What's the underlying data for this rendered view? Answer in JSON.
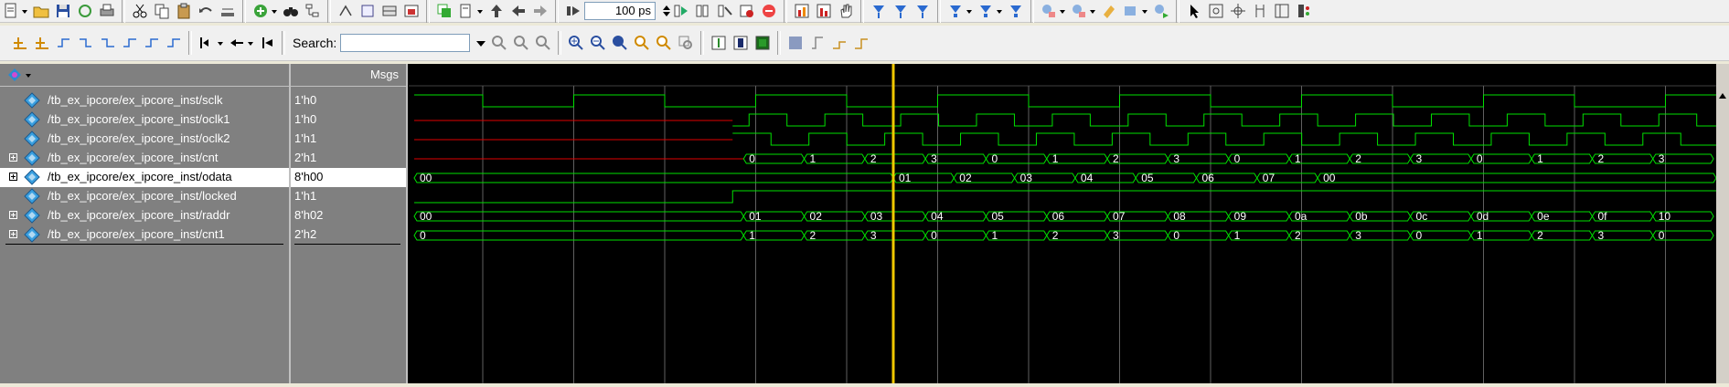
{
  "toolbar": {
    "zoom_value": "100 ps",
    "search_label": "Search:",
    "search_value": ""
  },
  "header": {
    "msgs_label": "Msgs"
  },
  "signals": [
    {
      "name": "/tb_ex_ipcore/ex_ipcore_inst/sclk",
      "value": "1'h0",
      "expandable": false
    },
    {
      "name": "/tb_ex_ipcore/ex_ipcore_inst/oclk1",
      "value": "1'h0",
      "expandable": false
    },
    {
      "name": "/tb_ex_ipcore/ex_ipcore_inst/oclk2",
      "value": "1'h1",
      "expandable": false
    },
    {
      "name": "/tb_ex_ipcore/ex_ipcore_inst/cnt",
      "value": "2'h1",
      "expandable": true
    },
    {
      "name": "/tb_ex_ipcore/ex_ipcore_inst/odata",
      "value": "8'h00",
      "expandable": true
    },
    {
      "name": "/tb_ex_ipcore/ex_ipcore_inst/locked",
      "value": "1'h1",
      "expandable": false
    },
    {
      "name": "/tb_ex_ipcore/ex_ipcore_inst/raddr",
      "value": "8'h02",
      "expandable": true
    },
    {
      "name": "/tb_ex_ipcore/ex_ipcore_inst/cnt1",
      "value": "2'h2",
      "expandable": true
    }
  ],
  "selected_signal_index": 4,
  "waves": {
    "cnt_values": [
      "0",
      "1",
      "2",
      "3",
      "0",
      "1",
      "2",
      "3",
      "0",
      "1",
      "2",
      "3",
      "0",
      "1",
      "2",
      "3"
    ],
    "odata_values": [
      "00",
      "01",
      "02",
      "03",
      "04",
      "05",
      "06",
      "07",
      "00"
    ],
    "raddr_values": [
      "00",
      "01",
      "02",
      "03",
      "04",
      "05",
      "06",
      "07",
      "08",
      "09",
      "0a",
      "0b",
      "0c",
      "0d",
      "0e",
      "0f",
      "10"
    ],
    "cnt1_values": [
      "0",
      "1",
      "2",
      "3",
      "0",
      "1",
      "2",
      "3",
      "0",
      "1",
      "2",
      "3",
      "0",
      "1",
      "2",
      "3",
      "0"
    ]
  },
  "colors": {
    "wave": "#00e000",
    "undefined": "#e00000",
    "cursor": "#f0c800",
    "grid": "#606060",
    "selected_row": "#ffffff"
  },
  "icons": [
    "new-icon",
    "open-icon",
    "save-icon",
    "reload-icon",
    "print-icon",
    "cut-icon",
    "copy-icon",
    "paste-icon",
    "undo-icon",
    "find-icon",
    "compile-icon",
    "simulate-icon",
    "break-icon",
    "run-icon",
    "step-icon",
    "wave-icon",
    "zoom-in-icon",
    "zoom-out-icon",
    "zoom-full-icon",
    "cursor-icon"
  ]
}
